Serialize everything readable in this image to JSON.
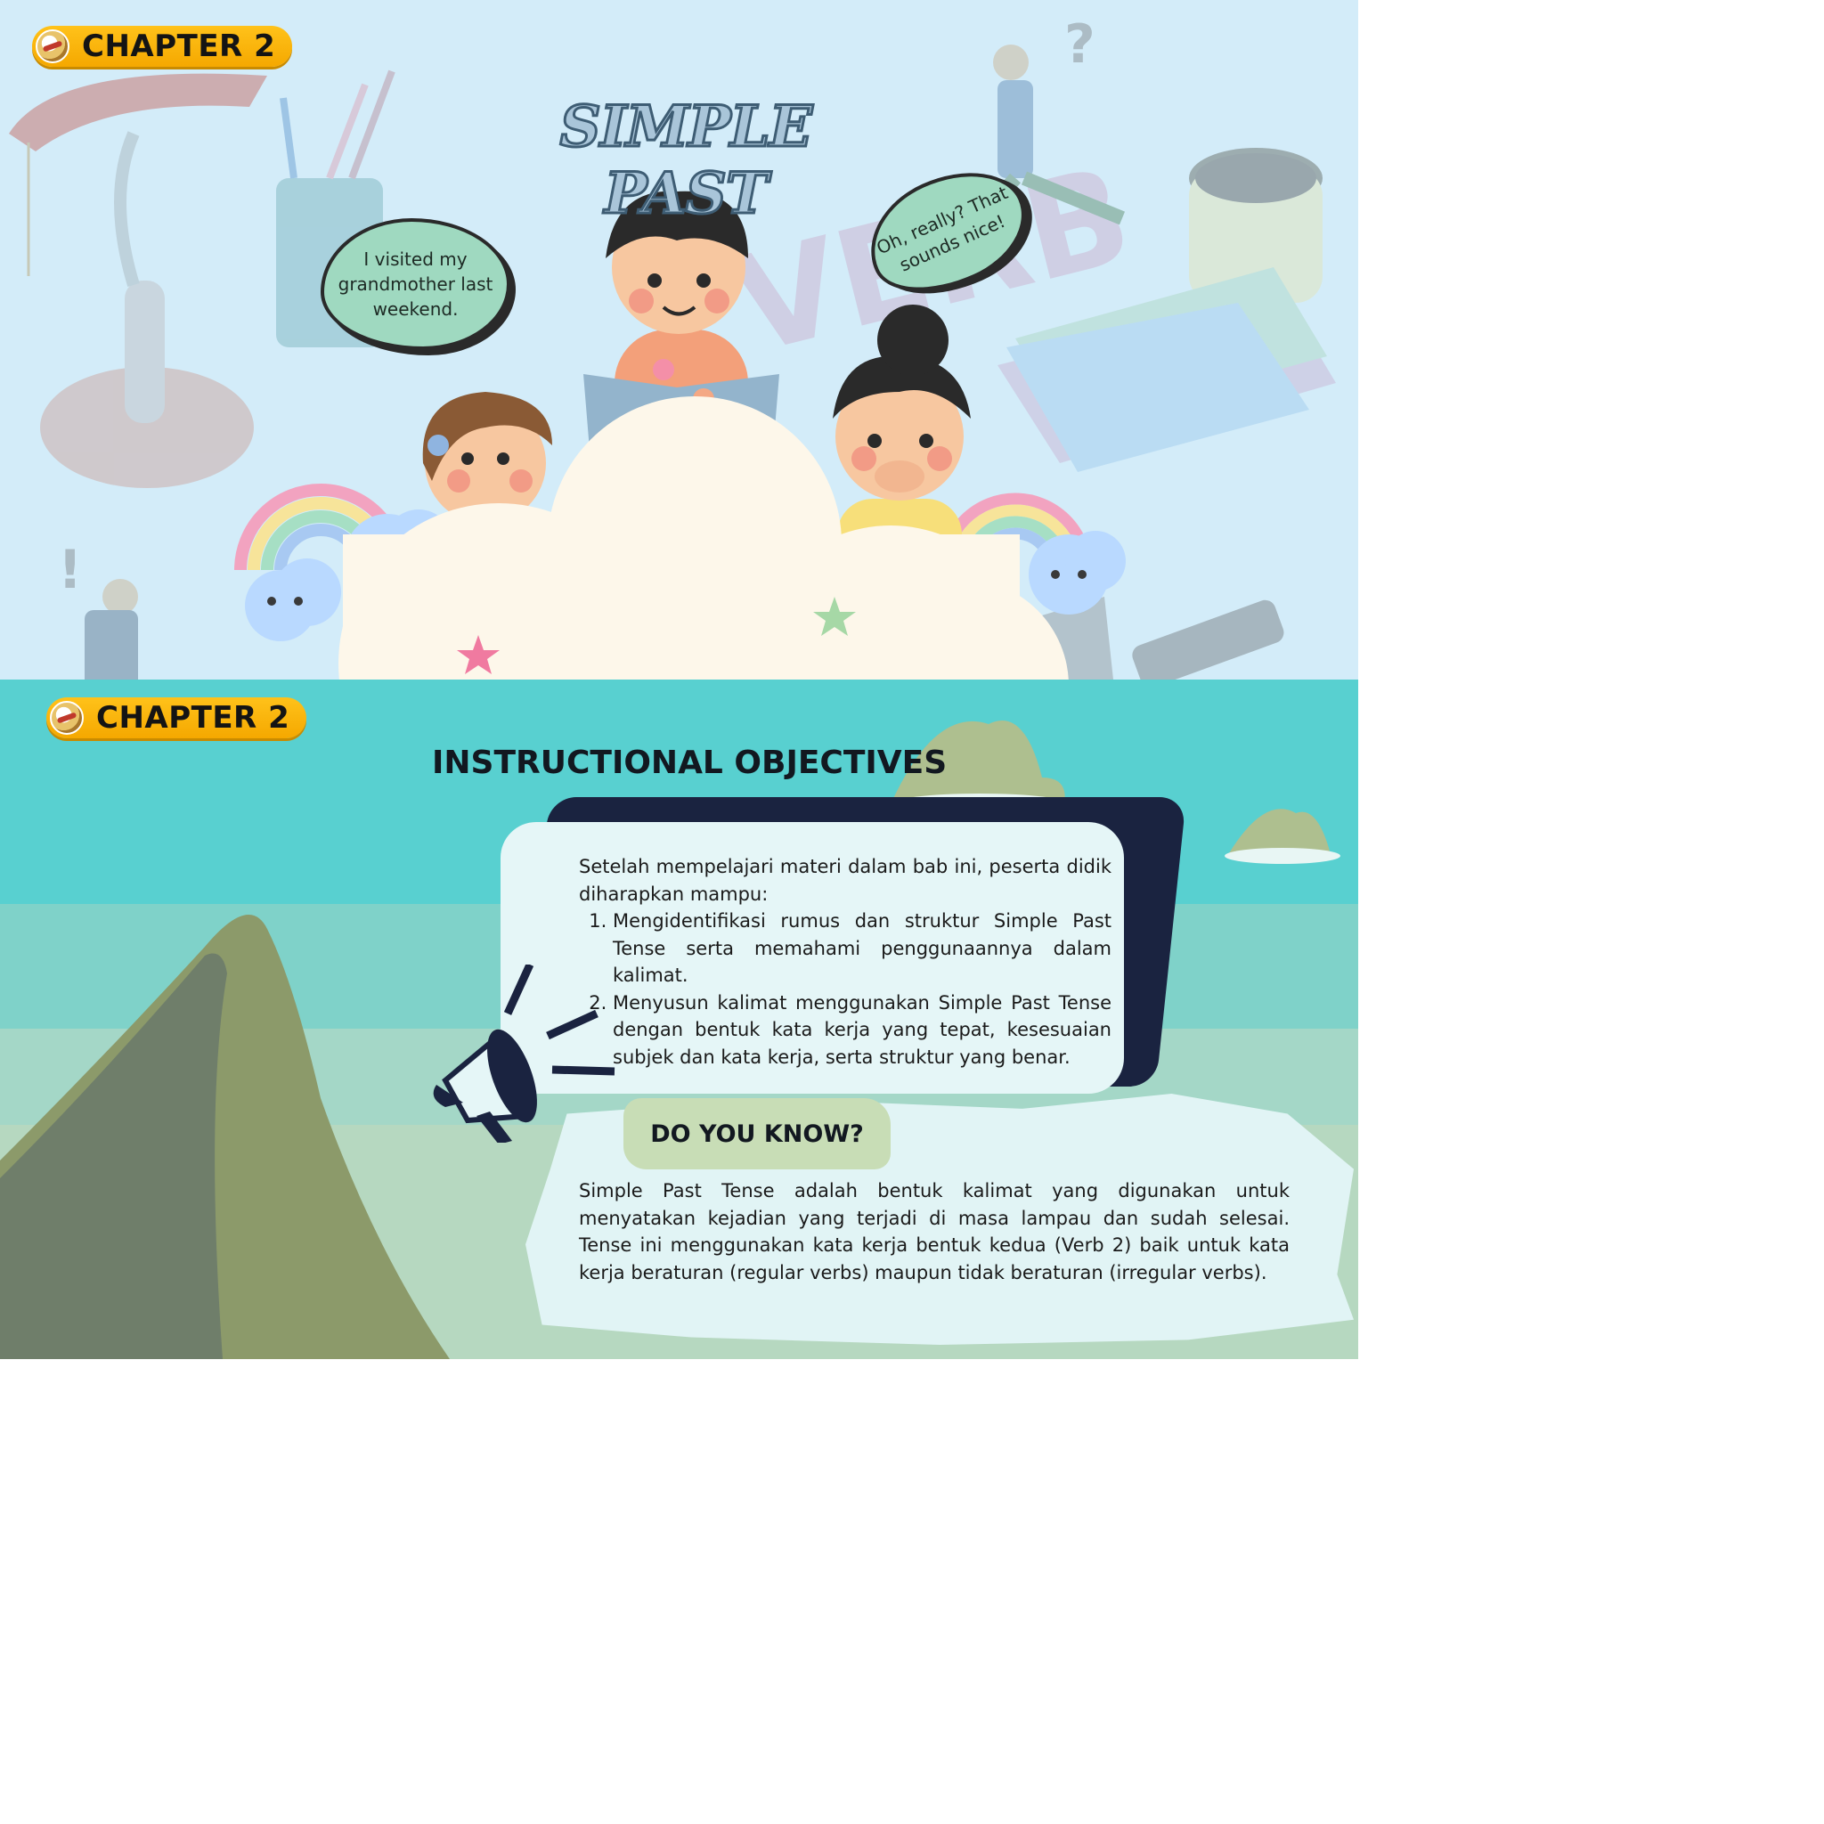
{
  "slide1": {
    "chapter_badge": "CHAPTER 2",
    "title": "SIMPLE PAST",
    "bubble_left": "I visited my grandmother last weekend.",
    "bubble_right": "Oh, really? That sounds nice!"
  },
  "slide2": {
    "chapter_badge": "CHAPTER 2",
    "heading": "INSTRUCTIONAL OBJECTIVES",
    "objectives_intro": "Setelah mempelajari materi dalam bab ini, peserta didik diharapkan mampu:",
    "objectives": [
      "Mengidentifikasi rumus dan struktur Simple Past Tense serta memahami penggunaannya dalam kalimat.",
      "Menyusun kalimat menggunakan Simple Past Tense dengan bentuk kata kerja yang tepat, kesesuaian subjek dan kata kerja, serta struktur yang benar."
    ],
    "do_you_know_label": "DO YOU KNOW?",
    "do_you_know_text": "Simple Past Tense adalah bentuk kalimat yang digunakan untuk menyatakan kejadian yang terjadi di masa lampau dan sudah selesai. Tense ini menggunakan kata kerja bentuk kedua (Verb 2) baik untuk kata kerja beraturan (regular verbs) maupun tidak beraturan (irregular verbs)."
  },
  "colors": {
    "badge_yellow": "#ffc21a",
    "slide1_bg": "#d3ecf9",
    "slide2_sky": "#58d0d0",
    "card_dark": "#1a2340",
    "bubble_green": "#9fd9c0"
  }
}
